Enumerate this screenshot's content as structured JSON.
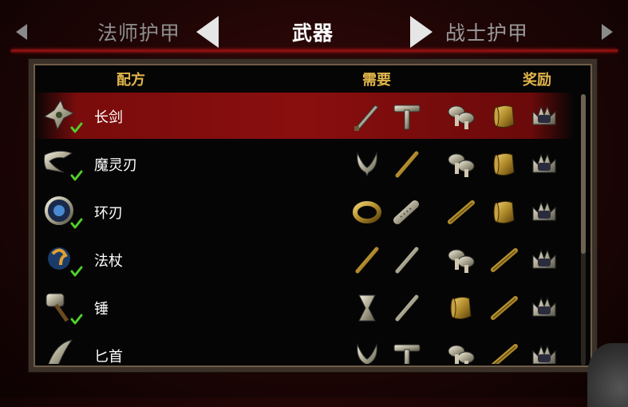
{
  "tabs": {
    "left_label": "法师护甲",
    "center_label": "武器",
    "right_label": "战士护甲"
  },
  "headers": {
    "recipe": "配方",
    "need": "需要",
    "reward": "奖励"
  },
  "recipes": [
    {
      "name": "长剑",
      "selected": true,
      "completed": true
    },
    {
      "name": "魔灵刃",
      "selected": false,
      "completed": true
    },
    {
      "name": "环刃",
      "selected": false,
      "completed": true
    },
    {
      "name": "法杖",
      "selected": false,
      "completed": true
    },
    {
      "name": "锤",
      "selected": false,
      "completed": true
    },
    {
      "name": "匕首",
      "selected": false,
      "completed": false
    }
  ],
  "colors": {
    "header_gold": "#e2b64a",
    "selected_row": "#8a0e0e",
    "accent_red": "#8a1010",
    "check_green": "#4fd02a"
  }
}
